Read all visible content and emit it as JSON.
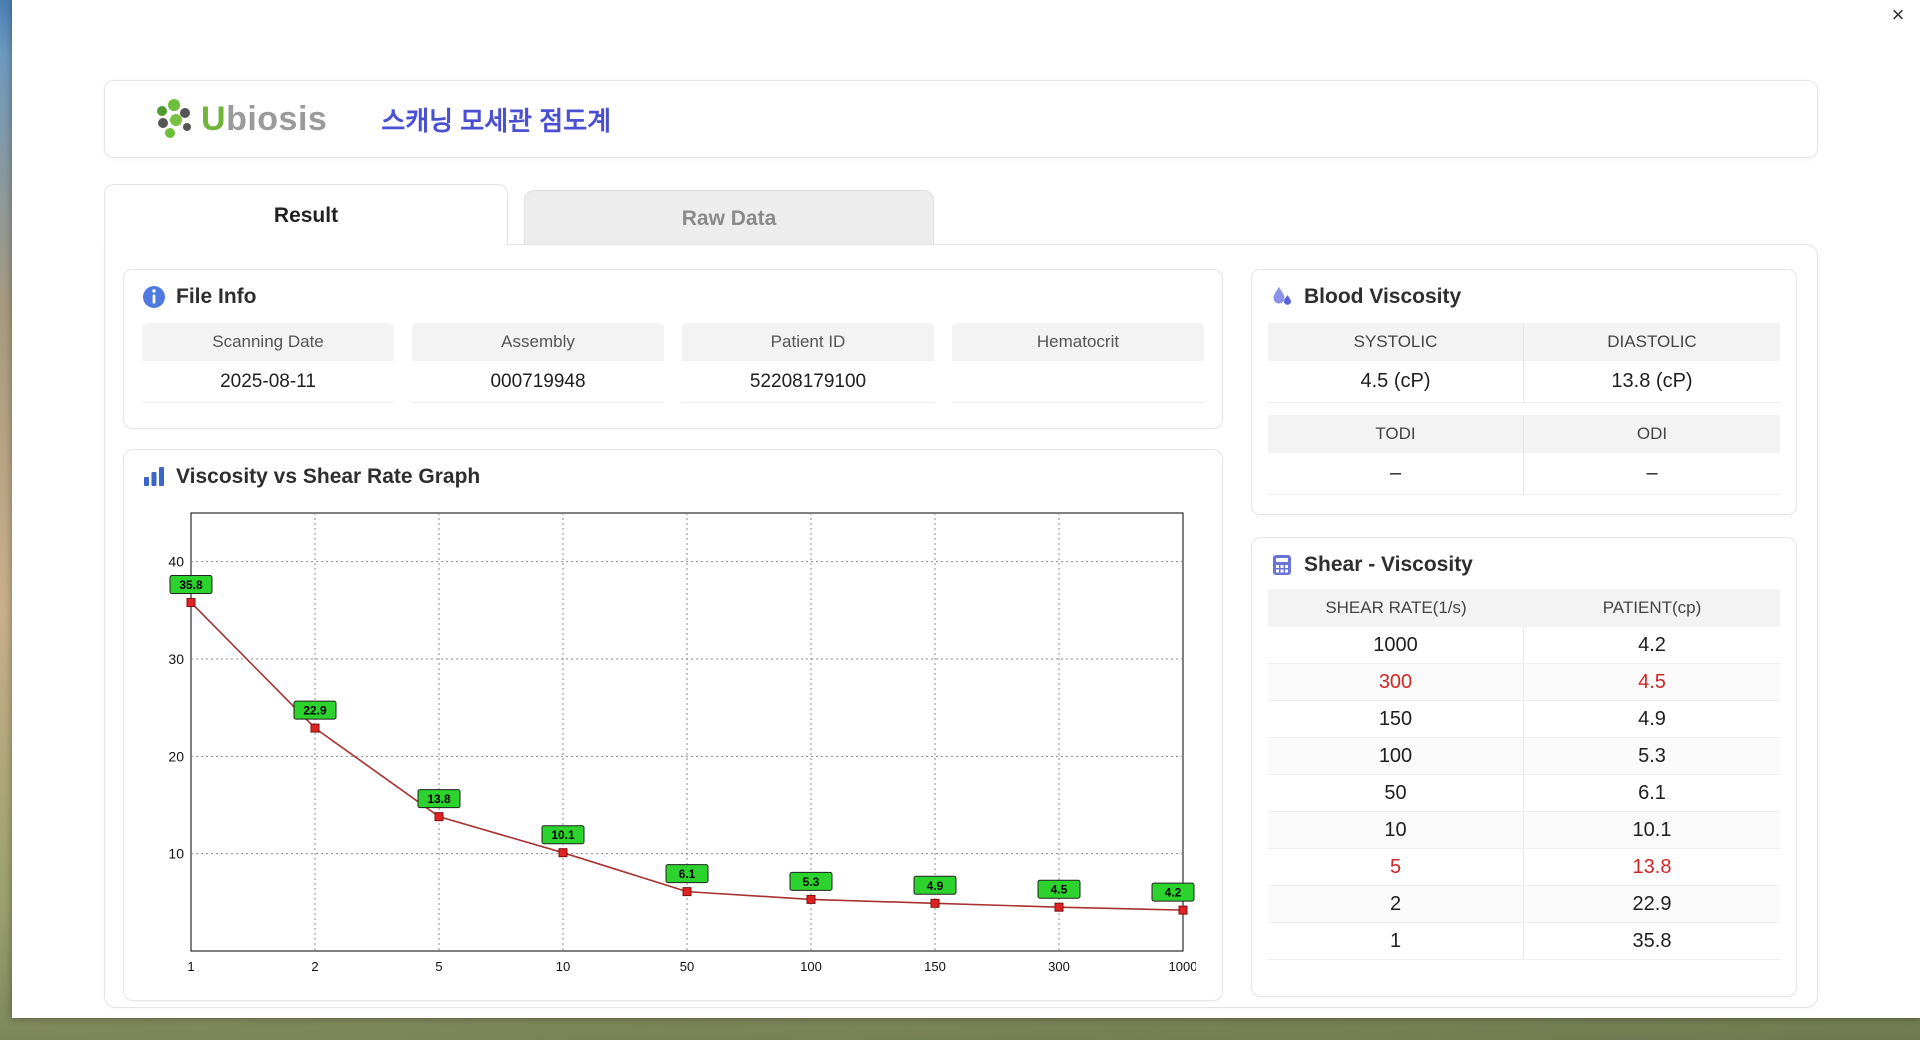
{
  "window": {
    "close_glyph": "×"
  },
  "header": {
    "brand_first": "U",
    "brand_rest": "biosis",
    "title": "스캐닝 모세관 점도계"
  },
  "tabs": [
    {
      "label": "Result",
      "active": true
    },
    {
      "label": "Raw Data",
      "active": false
    }
  ],
  "file_info": {
    "title": "File Info",
    "fields": [
      {
        "label": "Scanning Date",
        "value": "2025-08-11"
      },
      {
        "label": "Assembly",
        "value": "000719948"
      },
      {
        "label": "Patient ID",
        "value": "52208179100"
      },
      {
        "label": "Hematocrit",
        "value": ""
      }
    ]
  },
  "blood_viscosity": {
    "title": "Blood Viscosity",
    "head1": [
      "SYSTOLIC",
      "DIASTOLIC"
    ],
    "val1": [
      "4.5 (cP)",
      "13.8 (cP)"
    ],
    "head2": [
      "TODI",
      "ODI"
    ],
    "val2": [
      "–",
      "–"
    ]
  },
  "graph": {
    "title": "Viscosity vs Shear Rate Graph"
  },
  "chart_data": {
    "type": "line",
    "title": "Viscosity vs Shear Rate Graph",
    "categories": [
      1,
      2,
      5,
      10,
      50,
      100,
      150,
      300,
      1000
    ],
    "values": [
      35.8,
      22.9,
      13.8,
      10.1,
      6.1,
      5.3,
      4.9,
      4.5,
      4.2
    ],
    "point_labels": [
      "35.8",
      "22.9",
      "13.8",
      "10.1",
      "6.1",
      "5.3",
      "4.9",
      "4.5",
      "4.2"
    ],
    "xlabel": "",
    "ylabel": "",
    "ylim": [
      0,
      45
    ],
    "yticks": [
      10,
      20,
      30,
      40
    ],
    "x_scale": "category",
    "grid": "dotted",
    "legend": "none",
    "line_color": "#a83232",
    "marker_color": "#e22222",
    "marker_edge": "#7a1010",
    "label_bg": "#2cd32c"
  },
  "shear_table": {
    "title": "Shear - Viscosity",
    "columns": [
      "SHEAR RATE(1/s)",
      "PATIENT(cp)"
    ],
    "rows": [
      {
        "rate": "1000",
        "patient": "4.2",
        "highlight": false
      },
      {
        "rate": "300",
        "patient": "4.5",
        "highlight": true
      },
      {
        "rate": "150",
        "patient": "4.9",
        "highlight": false
      },
      {
        "rate": "100",
        "patient": "5.3",
        "highlight": false
      },
      {
        "rate": "50",
        "patient": "6.1",
        "highlight": false
      },
      {
        "rate": "10",
        "patient": "10.1",
        "highlight": false
      },
      {
        "rate": "5",
        "patient": "13.8",
        "highlight": true
      },
      {
        "rate": "2",
        "patient": "22.9",
        "highlight": false
      },
      {
        "rate": "1",
        "patient": "35.8",
        "highlight": false
      }
    ]
  },
  "colors": {
    "accent_blue": "#4b50d2",
    "logo_green": "#6fb53a",
    "highlight_red": "#cf2626"
  }
}
